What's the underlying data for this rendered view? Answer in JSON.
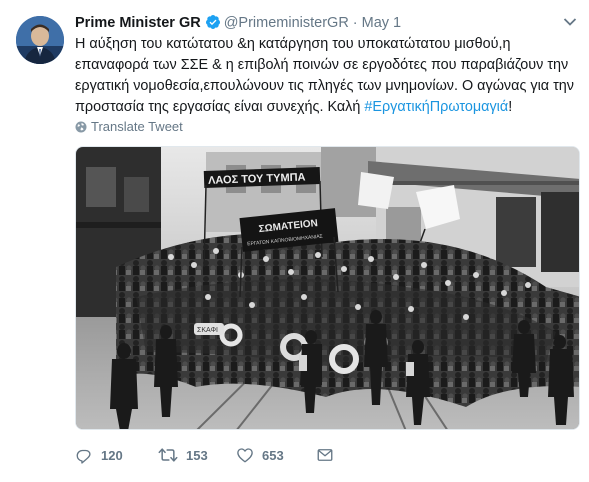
{
  "tweet": {
    "author_name": "Prime Minister GR",
    "author_handle": "@PrimeministerGR",
    "separator": "·",
    "date": "May 1",
    "text_main": "Η αύξηση του κατώτατου &η κατάργηση του υποκατώτατου μισθού,η επαναφορά των ΣΣΕ & η επιβολή ποινών σε εργοδότες που παραβιάζουν την εργατική νομοθεσία,επουλώνουν τις πληγές των μνημονίων. Ο αγώνας για την προστασία της εργασίας είναι συνεχής. Καλή ",
    "hashtag": "#ΕργατικήΠρωτομαγιά",
    "text_end": "!",
    "translate_label": "Translate Tweet"
  },
  "photo": {
    "banner_top": "ΛΑΟΣ ΤΟΥ ΤΥΜΠΑ",
    "banner_mid": "ΣΩΜΑΤΕΙΟΝ",
    "banner_mid_sub": "ΕΡΓΑΤΩΝ ΚΑΠΝΟΒΙΟΜΗΧΑΝΙΑΣ",
    "wreath_label": "ΣΚΑΦΙ"
  },
  "actions": {
    "reply_count": "120",
    "retweet_count": "153",
    "like_count": "653"
  },
  "colors": {
    "verified": "#1da1f2",
    "hashtag": "#1b95e0",
    "muted": "#657786"
  },
  "icons": {
    "verified": "verified-badge-icon",
    "caret": "chevron-down-icon",
    "globe": "globe-icon",
    "reply": "reply-icon",
    "retweet": "retweet-icon",
    "like": "heart-icon",
    "dm": "envelope-icon"
  }
}
